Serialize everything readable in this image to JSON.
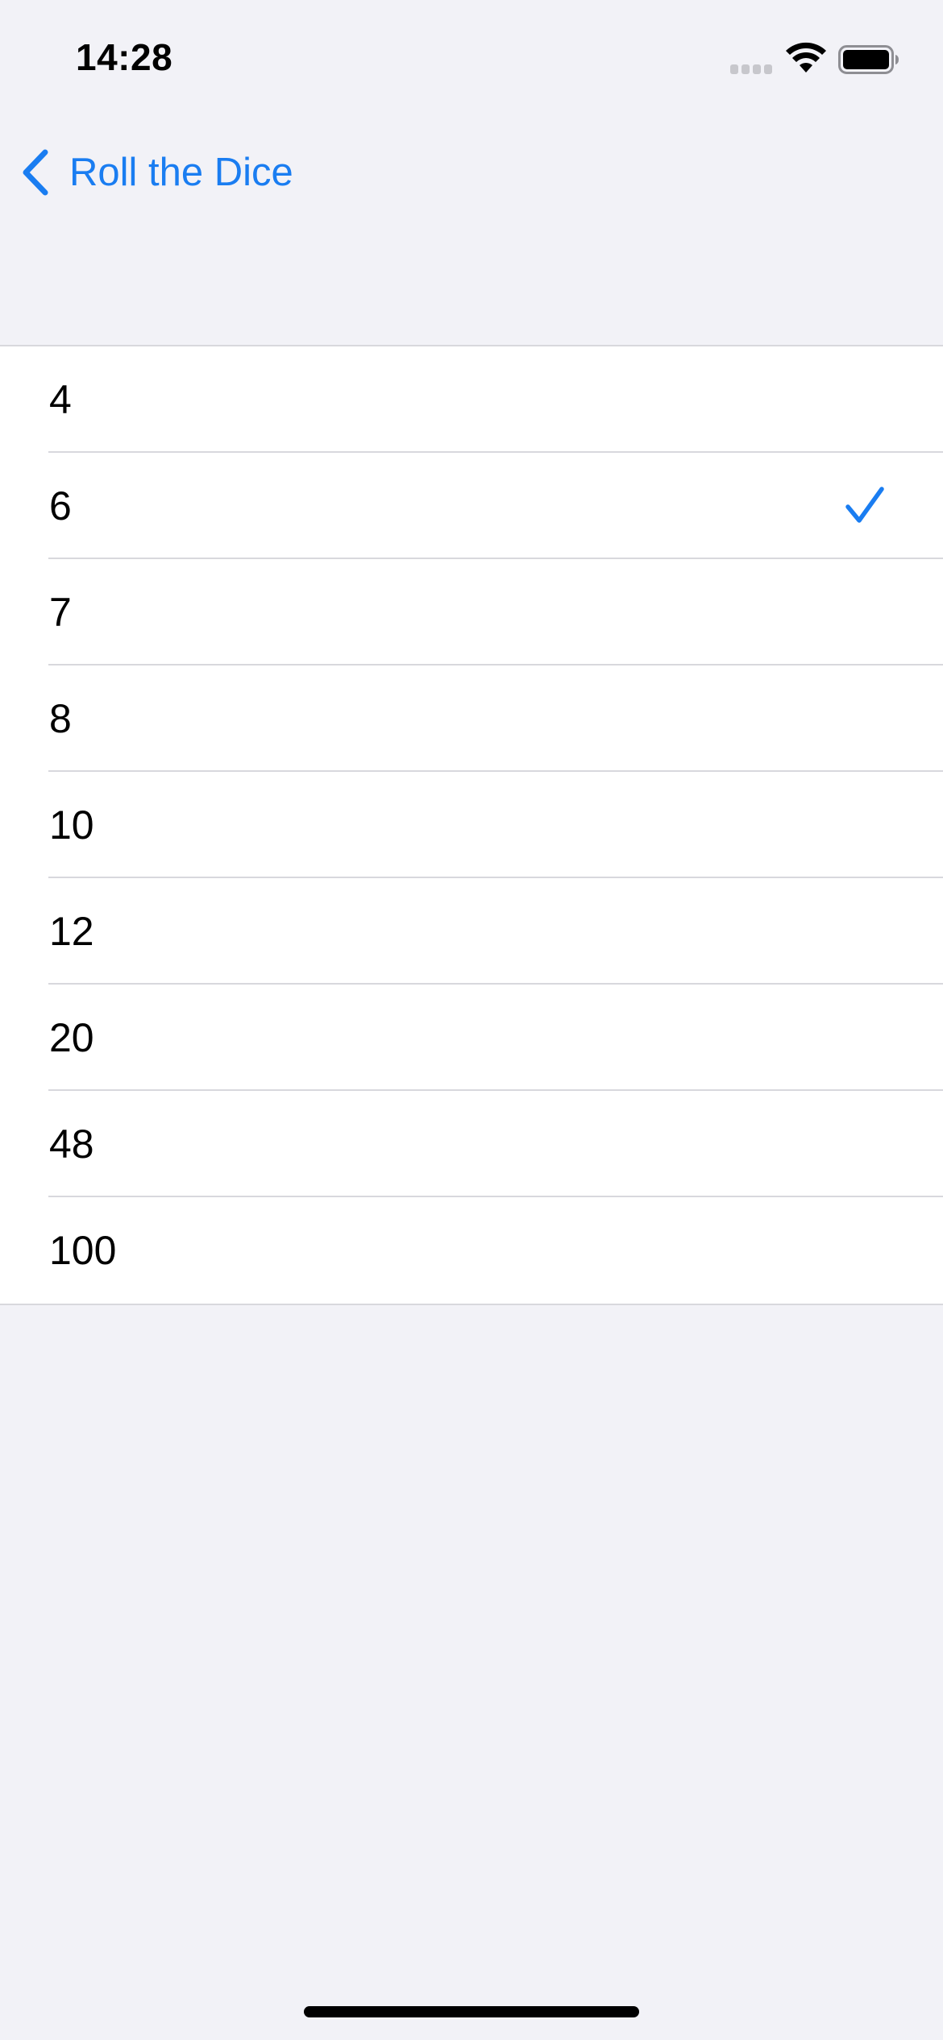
{
  "status_bar": {
    "time": "14:28"
  },
  "nav": {
    "back_label": "Roll the Dice"
  },
  "options": [
    {
      "label": "4",
      "selected": false
    },
    {
      "label": "6",
      "selected": true
    },
    {
      "label": "7",
      "selected": false
    },
    {
      "label": "8",
      "selected": false
    },
    {
      "label": "10",
      "selected": false
    },
    {
      "label": "12",
      "selected": false
    },
    {
      "label": "20",
      "selected": false
    },
    {
      "label": "48",
      "selected": false
    },
    {
      "label": "100",
      "selected": false
    }
  ],
  "icons": {
    "back": "chevron-left-icon",
    "selected": "checkmark-icon",
    "signal": "cellular-signal-icon",
    "wifi": "wifi-icon",
    "battery": "battery-icon"
  },
  "colors": {
    "accent": "#1A7DF1",
    "background": "#F2F2F7",
    "cell_background": "#FFFFFF",
    "separator": "#D8D8DD",
    "text": "#000000"
  }
}
